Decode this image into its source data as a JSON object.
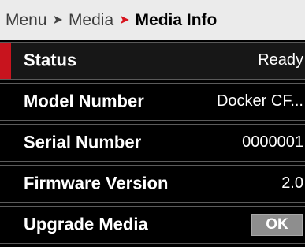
{
  "breadcrumb": {
    "root": "Menu",
    "parent": "Media",
    "current": "Media Info",
    "separator": "➤"
  },
  "rows": [
    {
      "label": "Status",
      "value": "Ready"
    },
    {
      "label": "Model Number",
      "value": "Docker CF..."
    },
    {
      "label": "Serial Number",
      "value": "0000001"
    },
    {
      "label": "Firmware Version",
      "value": "2.0"
    },
    {
      "label": "Upgrade Media",
      "button": "OK"
    }
  ],
  "colors": {
    "accent": "#c8141e",
    "header_bg": "#ebebeb",
    "background": "#000000",
    "button_bg": "#8e8e8e"
  }
}
